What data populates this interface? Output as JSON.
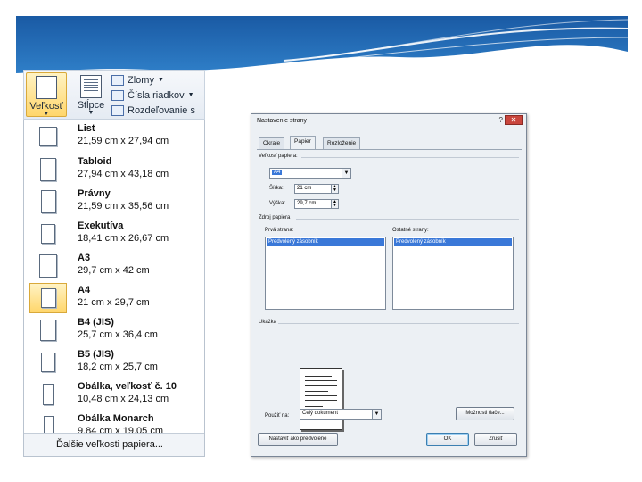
{
  "ribbon": {
    "size_label": "Veľkosť",
    "columns_label": "Stĺpce",
    "breaks_label": "Zlomy",
    "line_numbers_label": "Čísla riadkov",
    "hyphenation_label": "Rozdeľovanie s"
  },
  "gallery": {
    "items": [
      {
        "name": "List",
        "dims": "21,59 cm x 27,94 cm"
      },
      {
        "name": "Tabloid",
        "dims": "27,94 cm x 43,18 cm"
      },
      {
        "name": "Právny",
        "dims": "21,59 cm x 35,56 cm"
      },
      {
        "name": "Exekutíva",
        "dims": "18,41 cm x 26,67 cm"
      },
      {
        "name": "A3",
        "dims": "29,7 cm x 42 cm"
      },
      {
        "name": "A4",
        "dims": "21 cm x 29,7 cm"
      },
      {
        "name": "B4 (JIS)",
        "dims": "25,7 cm x 36,4 cm"
      },
      {
        "name": "B5 (JIS)",
        "dims": "18,2 cm x 25,7 cm"
      },
      {
        "name": "Obálka, veľkosť č. 10",
        "dims": "10,48 cm x 24,13 cm"
      },
      {
        "name": "Obálka Monarch",
        "dims": "9,84 cm x 19,05 cm"
      }
    ],
    "selected": "A4",
    "footer_label": "Ďalšie veľkosti papiera..."
  },
  "dialog": {
    "title": "Nastavenie strany",
    "help": "?",
    "close": "✕",
    "tabs": [
      "Okraje",
      "Papier",
      "Rozloženie"
    ],
    "active_tab": "Papier",
    "paper_size_label": "Veľkosť papiera:",
    "paper_size_value": "A4",
    "width_label": "Šírka:",
    "width_value": "21 cm",
    "height_label": "Výška:",
    "height_value": "29,7 cm",
    "paper_source_label": "Zdroj papiera",
    "first_page_label": "Prvá strana:",
    "first_page_value": "Predvolený zásobník",
    "other_pages_label": "Ostatné strany:",
    "other_pages_value": "Predvolený zásobník",
    "preview_label": "Ukážka",
    "apply_to_label": "Použiť na:",
    "apply_to_value": "Celý dokument",
    "print_options_button": "Možnosti tlače...",
    "set_default_button": "Nastaviť ako predvolené",
    "ok_button": "OK",
    "cancel_button": "Zrušiť"
  },
  "colors": {
    "header_blue": "#1f5fa8",
    "selection_blue": "#3a78d8",
    "ribbon_highlight": "#ffd66b"
  }
}
